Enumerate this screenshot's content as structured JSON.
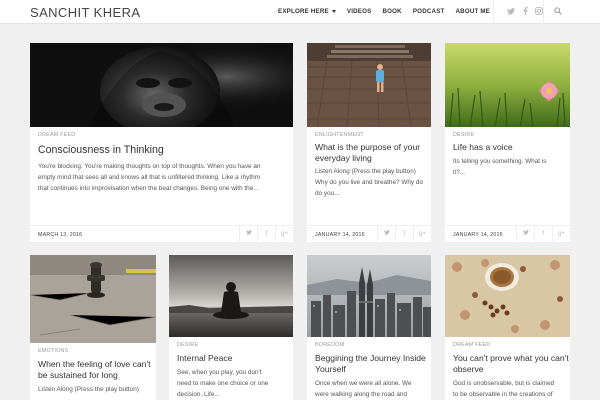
{
  "site": {
    "brand": "SANCHIT KHERA"
  },
  "nav": [
    {
      "label": "EXPLORE HERE",
      "dropdown": true
    },
    {
      "label": "VIDEOS"
    },
    {
      "label": "BOOK"
    },
    {
      "label": "PODCAST"
    },
    {
      "label": "ABOUT ME"
    }
  ],
  "social_icons": [
    "twitter-icon",
    "facebook-icon",
    "instagram-icon"
  ],
  "colors": {
    "header_bg": "#ffffff",
    "page_bg": "#f0f0f0",
    "text": "#333333",
    "muted": "#999999"
  },
  "share_glyphs": [
    "→",
    "f",
    "g⁺"
  ],
  "posts": [
    {
      "category": "DREAM FEED",
      "title": "Consciousness in Thinking",
      "excerpt_lines": [
        "You're blocking. You're making thoughts on top of thoughts. When you have an",
        "empty mind that sees all and knows all that is unfiltered thinking. Like a rhythm",
        "that continues into improvisation when the beat changes. Being one with the..."
      ],
      "date": "MARCH 13, 2016"
    },
    {
      "category": "ENLIGHTENMENT",
      "title_lines": [
        "What is the purpose of your",
        "everyday living"
      ],
      "excerpt_lines": [
        "Listen Along (Press the play button)",
        "Why do you live and breathe? Why do",
        "do you..."
      ],
      "date": "JANUARY 14, 2016"
    },
    {
      "category": "DESIRE",
      "title": "Life has a voice",
      "excerpt_lines": [
        "Its telling you something. What is",
        "it?..."
      ],
      "date": "JANUARY 14, 2016"
    },
    {
      "category": "EMOTIONS",
      "title_lines": [
        "When the feeling of love can't",
        "be sustained for long"
      ],
      "excerpt_lines": [
        "Listen Along (Press the play button)"
      ]
    },
    {
      "category": "DESIRE",
      "title": "Internal Peace",
      "excerpt_lines": [
        "See, when you play, you don't",
        "need to make one choice or one",
        "decision. Life..."
      ]
    },
    {
      "category": "BOREDOM",
      "title_lines": [
        "Beggining the Journey Inside",
        "Yourself"
      ],
      "excerpt_lines": [
        "Once when we were all alone. We",
        "were walking along the road and"
      ]
    },
    {
      "category": "DREAM FEED",
      "title_lines": [
        "You can't prove what you can't",
        "observe"
      ],
      "excerpt_lines": [
        "God is unobservable, but is claimed",
        "to be observable in the creations of"
      ]
    }
  ]
}
